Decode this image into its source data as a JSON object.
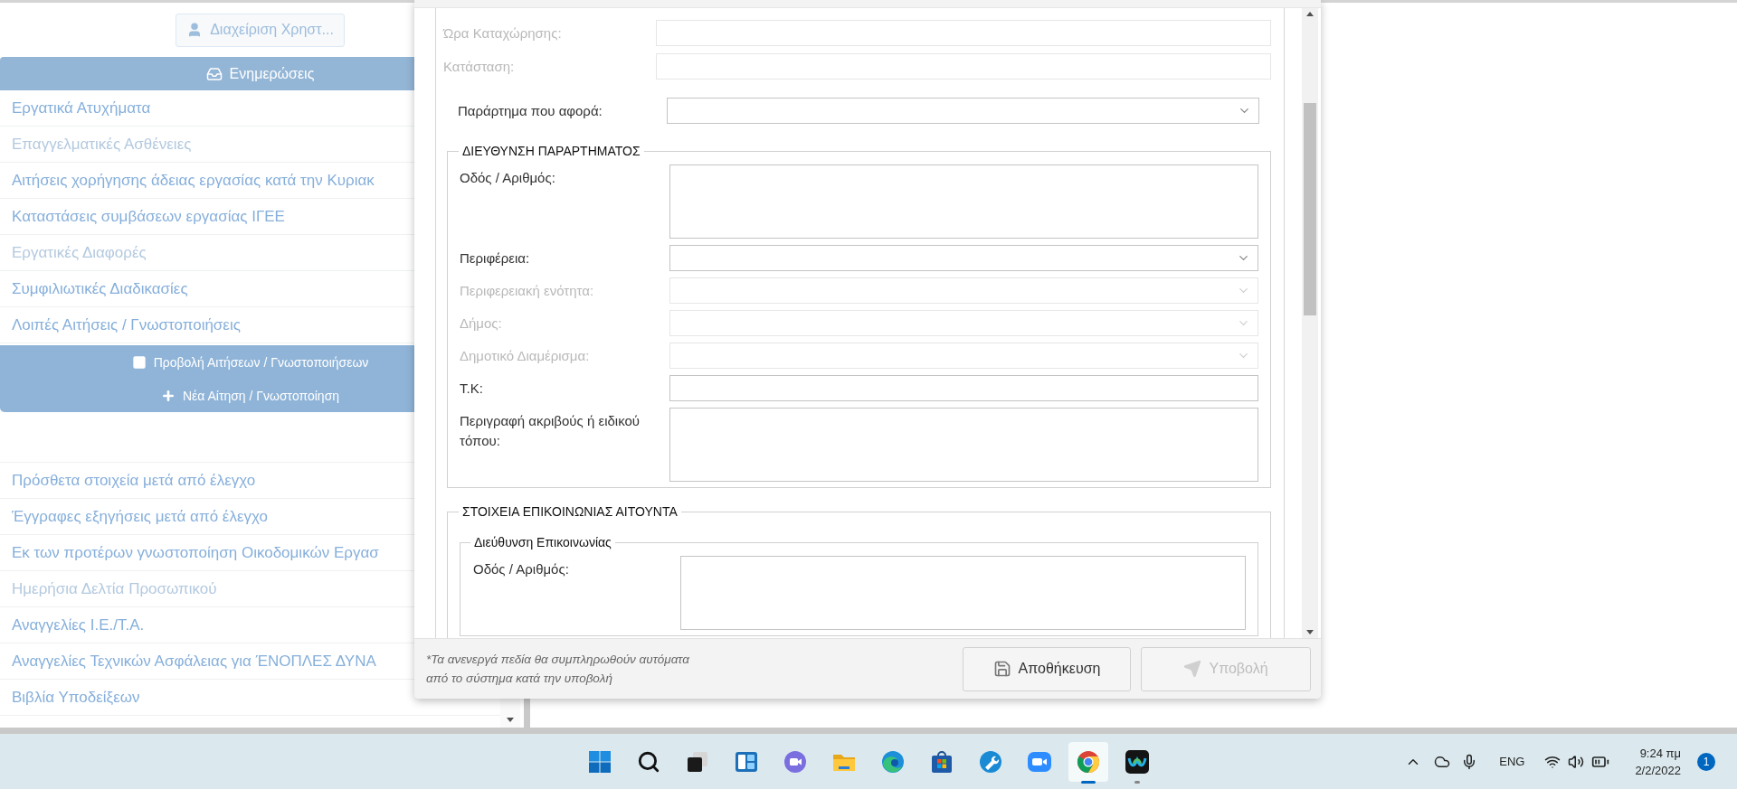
{
  "sidebar": {
    "user_button": {
      "label": "Διαχείριση Χρηστ...",
      "disabled": true
    },
    "section_bar": {
      "label": "Ενημερώσεις"
    },
    "items_top": [
      {
        "label": "Εργατικά Ατυχήματα",
        "disabled": false
      },
      {
        "label": "Επαγγελματικές Ασθένειες",
        "disabled": true
      },
      {
        "label": "Αιτήσεις χορήγησης άδειας εργασίας κατά την Κυριακ",
        "disabled": false
      },
      {
        "label": "Καταστάσεις συμβάσεων εργασίας ΙΓΕΕ",
        "disabled": false
      },
      {
        "label": "Εργατικές Διαφορές",
        "disabled": true
      },
      {
        "label": "Συμφιλιωτικές Διαδικασίες",
        "disabled": false
      },
      {
        "label": "Λοιπές Αιτήσεις / Γνωστοποιήσεις",
        "disabled": false
      }
    ],
    "actions": [
      {
        "kind": "list",
        "label": "Προβολή Αιτήσεων / Γνωστοποιήσεων"
      },
      {
        "kind": "add",
        "label": "Νέα Αίτηση / Γνωστοποίηση"
      }
    ],
    "items_bottom": [
      {
        "label": "Πρόσθετα στοιχεία μετά από έλεγχο",
        "disabled": false
      },
      {
        "label": "Έγγραφες εξηγήσεις μετά από έλεγχο",
        "disabled": false
      },
      {
        "label": "Εκ των προτέρων γνωστοποίηση Οικοδομικών Εργασ",
        "disabled": false
      },
      {
        "label": "Ημερήσια Δελτία Προσωπικού",
        "disabled": true
      },
      {
        "label": "Αναγγελίες Ι.Ε./Τ.Α.",
        "disabled": false
      },
      {
        "label": "Αναγγελίες Τεχνικών Ασφάλειας για ΈΝΟΠΛΕΣ ΔΥΝΑ",
        "disabled": false
      },
      {
        "label": "Βιβλία Υποδείξεων",
        "disabled": false
      }
    ]
  },
  "modal": {
    "fields": [
      {
        "label": "Ώρα Καταχώρησης:",
        "kind": "input",
        "disabled": true
      },
      {
        "label": "Κατάσταση:",
        "kind": "input",
        "disabled": true
      }
    ],
    "branch_field": {
      "label": "Παράρτημα που αφορά:",
      "kind": "select",
      "disabled": false
    },
    "sections": [
      {
        "legend": "ΔΙΕΥΘΥΝΣΗ ΠΑΡΑΡΤΗΜΑΤΟΣ",
        "fields": [
          {
            "label": "Οδός / Αριθμός:",
            "kind": "textarea",
            "disabled": false
          },
          {
            "label": "Περιφέρεια:",
            "kind": "select",
            "disabled": false
          },
          {
            "label": "Περιφερειακή ενότητα:",
            "kind": "select",
            "disabled": true
          },
          {
            "label": "Δήμος:",
            "kind": "select",
            "disabled": true
          },
          {
            "label": "Δημοτικό Διαμέρισμα:",
            "kind": "select",
            "disabled": true
          },
          {
            "label": "Τ.Κ:",
            "kind": "input",
            "disabled": false
          },
          {
            "label": "Περιγραφή ακριβούς ή ειδικού τόπου:",
            "kind": "textarea",
            "disabled": false
          }
        ]
      },
      {
        "legend": "ΣΤΟΙΧΕΙΑ ΕΠΙΚΟΙΝΩΝΙΑΣ ΑΙΤΟΥΝΤΑ",
        "subsections": [
          {
            "legend": "Διεύθυνση Επικοινωνίας",
            "fields": [
              {
                "label": "Οδός / Αριθμός:",
                "kind": "textarea",
                "disabled": false
              }
            ]
          }
        ]
      }
    ],
    "footer": {
      "note_lines": [
        "*Τα ανενεργά πεδία θα συμπληρωθούν αυτόματα",
        "από το σύστημα κατά την υποβολή"
      ],
      "buttons": [
        {
          "kind": "save",
          "label": "Αποθήκευση",
          "disabled": false
        },
        {
          "kind": "submit",
          "label": "Υποβολή",
          "disabled": true
        }
      ]
    }
  },
  "taskbar": {
    "apps": [
      {
        "kind": "start",
        "selected": false,
        "running": false
      },
      {
        "kind": "search",
        "selected": false,
        "running": false
      },
      {
        "kind": "taskview",
        "selected": false,
        "running": false
      },
      {
        "kind": "widgets",
        "selected": false,
        "running": false
      },
      {
        "kind": "chat",
        "selected": false,
        "running": false
      },
      {
        "kind": "explorer",
        "selected": false,
        "running": false
      },
      {
        "kind": "edge",
        "selected": false,
        "running": false
      },
      {
        "kind": "store",
        "selected": false,
        "running": false
      },
      {
        "kind": "tool",
        "selected": false,
        "running": false
      },
      {
        "kind": "zoom",
        "selected": false,
        "running": false
      },
      {
        "kind": "chrome",
        "selected": true,
        "running": true
      },
      {
        "kind": "webex",
        "selected": false,
        "running": true
      }
    ],
    "tray": {
      "language": "ENG",
      "time": "9:24 πμ",
      "date": "2/2/2022",
      "notifications": "1"
    }
  }
}
